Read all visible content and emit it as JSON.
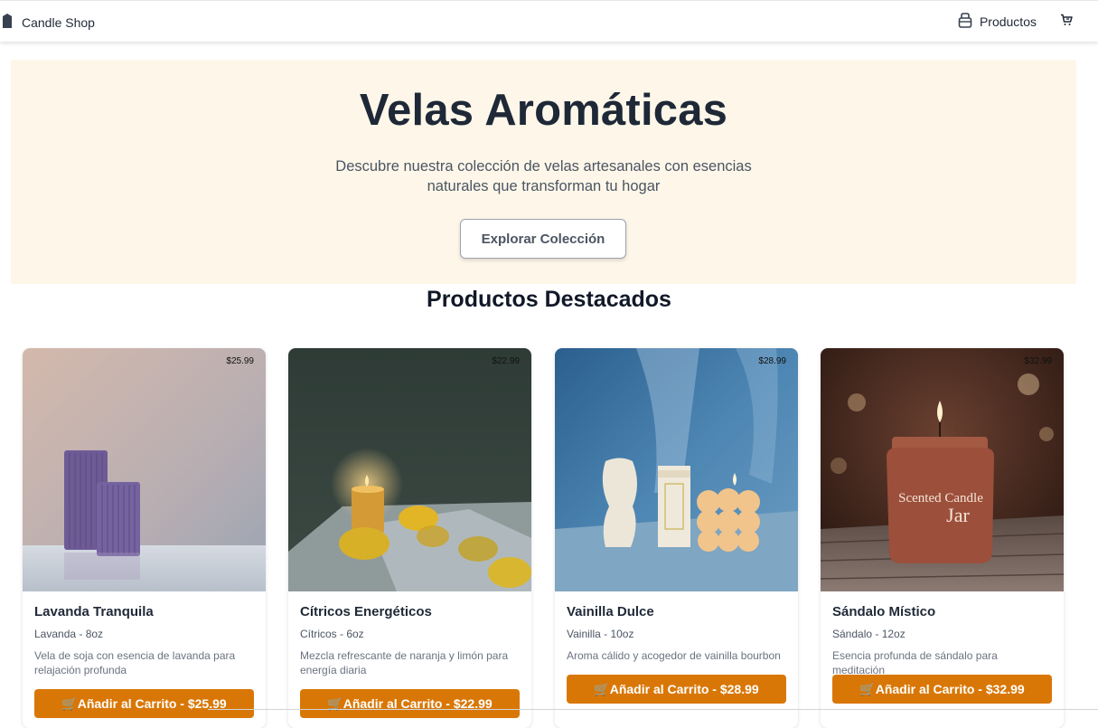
{
  "nav": {
    "brand": "Candle Shop",
    "products_label": "Productos",
    "icons": {
      "brand": "candle-icon",
      "products": "package-icon",
      "cart": "cart-icon"
    }
  },
  "hero": {
    "title": "Velas Aromáticas",
    "subtitle_line1": "Descubre nuestra colección de velas artesanales con esencias",
    "subtitle_line2": "naturales que transforman tu hogar",
    "cta": "Explorar Colección"
  },
  "section_title": "Productos Destacados",
  "products": [
    {
      "name": "Lavanda Tranquila",
      "meta": "Lavanda - 8oz",
      "description": "Vela de soja con esencia de lavanda para relajación profunda",
      "price": "$25.99",
      "button": "🛒Añadir al Carrito - $25.99"
    },
    {
      "name": "Cítricos Energéticos",
      "meta": "Cítricos - 6oz",
      "description": "Mezcla refrescante de naranja y limón para energía diaria",
      "price": "$22.99",
      "button": "🛒Añadir al Carrito - $22.99"
    },
    {
      "name": "Vainilla Dulce",
      "meta": "Vainilla - 10oz",
      "description": "Aroma cálido y acogedor de vainilla bourbon",
      "price": "$28.99",
      "button": "🛒Añadir al Carrito - $28.99"
    },
    {
      "name": "Sándalo Místico",
      "meta": "Sándalo - 12oz",
      "description": "Esencia profunda de sándalo para meditación",
      "price": "$32.99",
      "button": "🛒Añadir al Carrito - $32.99"
    }
  ],
  "colors": {
    "accent": "#d97706",
    "hero_bg": "#fef7e9",
    "text_dark": "#1e2837"
  }
}
